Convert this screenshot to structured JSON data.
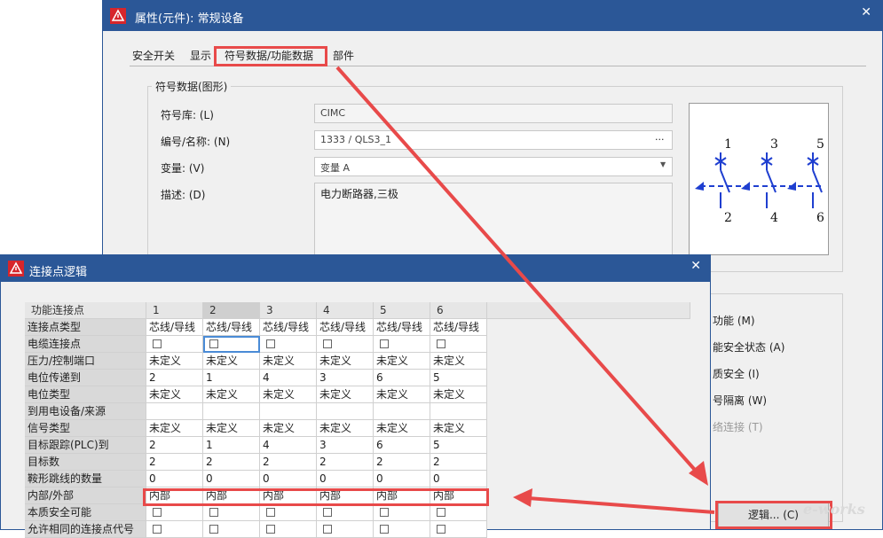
{
  "main": {
    "title": "属性(元件): 常规设备",
    "tabs": [
      "安全开关",
      "显示",
      "符号数据/功能数据",
      "部件"
    ],
    "group_title": "符号数据(图形)",
    "fields": [
      {
        "label": "符号库: (L)",
        "value": "CIMC"
      },
      {
        "label": "编号/名称: (N)",
        "value": "1333 / QLS3_1",
        "button": "..."
      },
      {
        "label": "变量: (V)",
        "value": "变量 A"
      },
      {
        "label": "描述: (D)",
        "value": "电力断路器,三极"
      }
    ],
    "preview_numbers": {
      "top": [
        "1",
        "3",
        "5"
      ],
      "bottom": [
        "2",
        "4",
        "6"
      ]
    },
    "right_buttons": [
      "功能 (M)",
      "能安全状态 (A)",
      "质安全 (I)",
      "号隔离 (W)",
      "络连接 (T)"
    ],
    "logic_button": "逻辑... (C)"
  },
  "dialog": {
    "title": "连接点逻辑",
    "columns": [
      "功能连接点",
      "1",
      "2",
      "3",
      "4",
      "5",
      "6"
    ],
    "rows": [
      {
        "label": "连接点类型",
        "type": "text",
        "values": [
          "芯线/导线",
          "芯线/导线",
          "芯线/导线",
          "芯线/导线",
          "芯线/导线",
          "芯线/导线"
        ]
      },
      {
        "label": "电缆连接点",
        "type": "check",
        "values": [
          "",
          "",
          "",
          "",
          "",
          ""
        ]
      },
      {
        "label": "压力/控制端口",
        "type": "text",
        "values": [
          "未定义",
          "未定义",
          "未定义",
          "未定义",
          "未定义",
          "未定义"
        ]
      },
      {
        "label": "电位传递到",
        "type": "text",
        "values": [
          "2",
          "1",
          "4",
          "3",
          "6",
          "5"
        ]
      },
      {
        "label": "电位类型",
        "type": "text",
        "values": [
          "未定义",
          "未定义",
          "未定义",
          "未定义",
          "未定义",
          "未定义"
        ]
      },
      {
        "label": "到用电设备/来源",
        "type": "text",
        "values": [
          "",
          "",
          "",
          "",
          "",
          ""
        ]
      },
      {
        "label": "信号类型",
        "type": "text",
        "values": [
          "未定义",
          "未定义",
          "未定义",
          "未定义",
          "未定义",
          "未定义"
        ]
      },
      {
        "label": "目标跟踪(PLC)到",
        "type": "text",
        "values": [
          "2",
          "1",
          "4",
          "3",
          "6",
          "5"
        ]
      },
      {
        "label": "目标数",
        "type": "text",
        "values": [
          "2",
          "2",
          "2",
          "2",
          "2",
          "2"
        ]
      },
      {
        "label": "鞍形跳线的数量",
        "type": "text",
        "values": [
          "0",
          "0",
          "0",
          "0",
          "0",
          "0"
        ]
      },
      {
        "label": "内部/外部",
        "type": "text",
        "values": [
          "内部",
          "内部",
          "内部",
          "内部",
          "内部",
          "内部"
        ]
      },
      {
        "label": "本质安全可能",
        "type": "check",
        "values": [
          "",
          "",
          "",
          "",
          "",
          ""
        ]
      },
      {
        "label": "允许相同的连接点代号",
        "type": "check",
        "values": [
          "",
          "",
          "",
          "",
          "",
          ""
        ]
      }
    ]
  },
  "watermark": "e-works",
  "colors": {
    "titlebar": "#2b5797",
    "highlight": "#e84a4a",
    "icon": "#d7262b"
  }
}
